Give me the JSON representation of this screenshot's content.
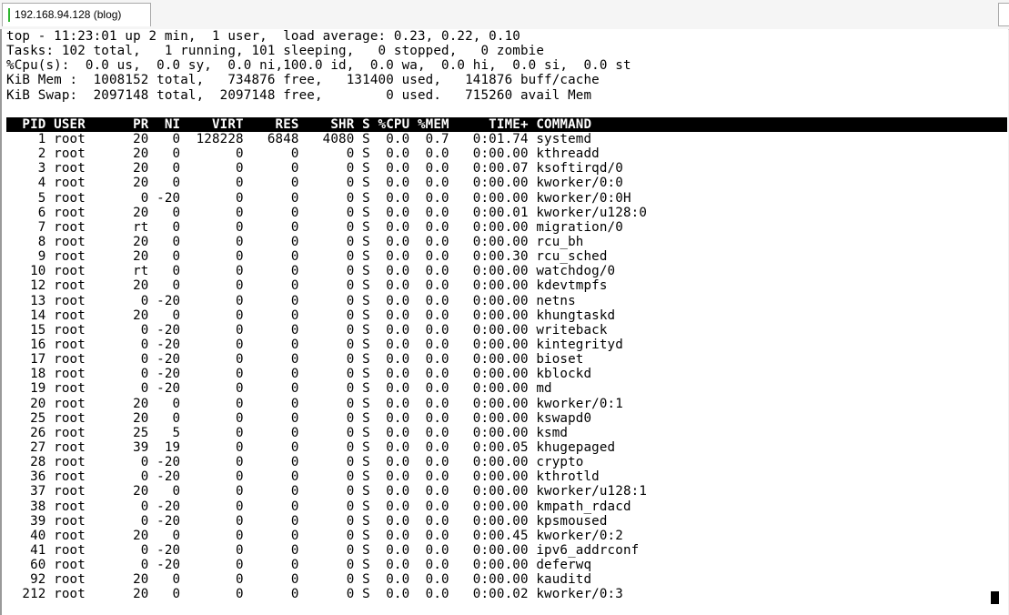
{
  "window": {
    "tab_title": "192.168.94.128 (blog)"
  },
  "summary": [
    "top - 11:23:01 up 2 min,  1 user,  load average: 0.23, 0.22, 0.10",
    "Tasks: 102 total,   1 running, 101 sleeping,   0 stopped,   0 zombie",
    "%Cpu(s):  0.0 us,  0.0 sy,  0.0 ni,100.0 id,  0.0 wa,  0.0 hi,  0.0 si,  0.0 st",
    "KiB Mem :  1008152 total,   734876 free,   131400 used,   141876 buff/cache",
    "KiB Swap:  2097148 total,  2097148 free,        0 used.   715260 avail Mem"
  ],
  "process_header": "  PID USER      PR  NI    VIRT    RES    SHR S %CPU %MEM     TIME+ COMMAND",
  "processes": [
    "    1 root      20   0  128228   6848   4080 S  0.0  0.7   0:01.74 systemd",
    "    2 root      20   0       0      0      0 S  0.0  0.0   0:00.00 kthreadd",
    "    3 root      20   0       0      0      0 S  0.0  0.0   0:00.07 ksoftirqd/0",
    "    4 root      20   0       0      0      0 S  0.0  0.0   0:00.00 kworker/0:0",
    "    5 root       0 -20       0      0      0 S  0.0  0.0   0:00.00 kworker/0:0H",
    "    6 root      20   0       0      0      0 S  0.0  0.0   0:00.01 kworker/u128:0",
    "    7 root      rt   0       0      0      0 S  0.0  0.0   0:00.00 migration/0",
    "    8 root      20   0       0      0      0 S  0.0  0.0   0:00.00 rcu_bh",
    "    9 root      20   0       0      0      0 S  0.0  0.0   0:00.30 rcu_sched",
    "   10 root      rt   0       0      0      0 S  0.0  0.0   0:00.00 watchdog/0",
    "   12 root      20   0       0      0      0 S  0.0  0.0   0:00.00 kdevtmpfs",
    "   13 root       0 -20       0      0      0 S  0.0  0.0   0:00.00 netns",
    "   14 root      20   0       0      0      0 S  0.0  0.0   0:00.00 khungtaskd",
    "   15 root       0 -20       0      0      0 S  0.0  0.0   0:00.00 writeback",
    "   16 root       0 -20       0      0      0 S  0.0  0.0   0:00.00 kintegrityd",
    "   17 root       0 -20       0      0      0 S  0.0  0.0   0:00.00 bioset",
    "   18 root       0 -20       0      0      0 S  0.0  0.0   0:00.00 kblockd",
    "   19 root       0 -20       0      0      0 S  0.0  0.0   0:00.00 md",
    "   20 root      20   0       0      0      0 S  0.0  0.0   0:00.00 kworker/0:1",
    "   25 root      20   0       0      0      0 S  0.0  0.0   0:00.00 kswapd0",
    "   26 root      25   5       0      0      0 S  0.0  0.0   0:00.00 ksmd",
    "   27 root      39  19       0      0      0 S  0.0  0.0   0:00.05 khugepaged",
    "   28 root       0 -20       0      0      0 S  0.0  0.0   0:00.00 crypto",
    "   36 root       0 -20       0      0      0 S  0.0  0.0   0:00.00 kthrotld",
    "   37 root      20   0       0      0      0 S  0.0  0.0   0:00.00 kworker/u128:1",
    "   38 root       0 -20       0      0      0 S  0.0  0.0   0:00.00 kmpath_rdacd",
    "   39 root       0 -20       0      0      0 S  0.0  0.0   0:00.00 kpsmoused",
    "   40 root      20   0       0      0      0 S  0.0  0.0   0:00.45 kworker/0:2",
    "   41 root       0 -20       0      0      0 S  0.0  0.0   0:00.00 ipv6_addrconf",
    "   60 root       0 -20       0      0      0 S  0.0  0.0   0:00.00 deferwq",
    "   92 root      20   0       0      0      0 S  0.0  0.0   0:00.00 kauditd",
    "  212 root      20   0       0      0      0 S  0.0  0.0   0:00.02 kworker/0:3"
  ],
  "colors": {
    "terminal_bg": "#ffffff",
    "terminal_fg": "#000000",
    "header_bg": "#000000",
    "header_fg": "#ffffff",
    "tab_marker": "#2fb52f"
  }
}
